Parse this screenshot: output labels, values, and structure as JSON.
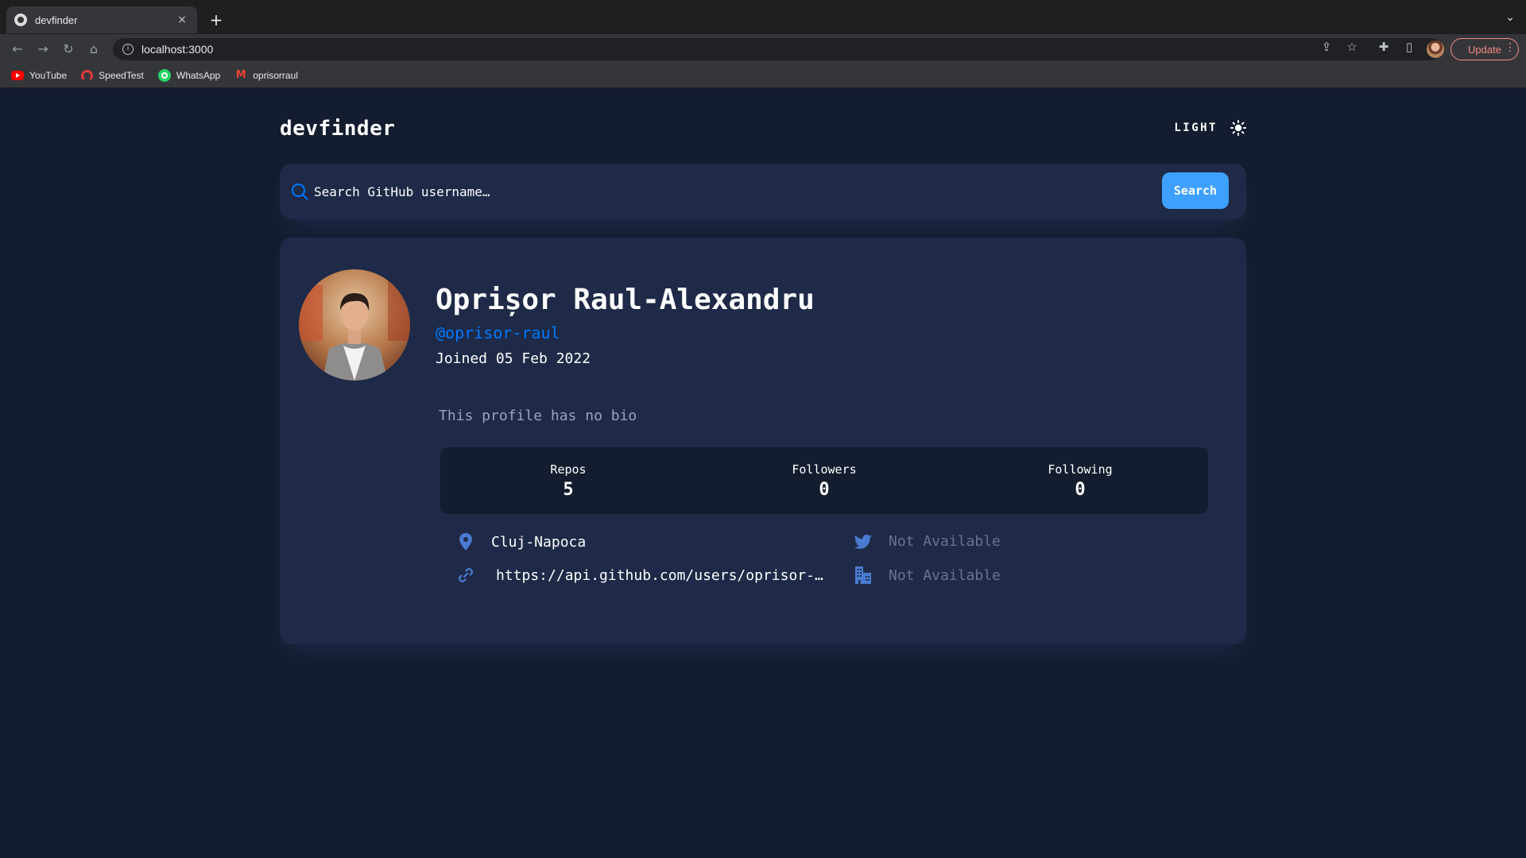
{
  "browser": {
    "tab_title": "devfinder",
    "tab_close_glyph": "×",
    "new_tab_glyph": "+",
    "url": "localhost:3000",
    "update_label": "Update",
    "bookmarks": [
      {
        "label": "YouTube",
        "icon": "youtube-icon"
      },
      {
        "label": "SpeedTest",
        "icon": "speedtest-icon"
      },
      {
        "label": "WhatsApp",
        "icon": "whatsapp-icon"
      },
      {
        "label": "oprisorraul",
        "icon": "gmail-icon"
      }
    ]
  },
  "header": {
    "logo": "devfinder",
    "theme_label": "LIGHT"
  },
  "search": {
    "placeholder": "Search GitHub username…",
    "value": "",
    "button_label": "Search"
  },
  "profile": {
    "name": "Oprișor Raul-Alexandru",
    "handle": "@oprisor-raul",
    "joined": "Joined 05 Feb 2022",
    "bio": "This profile has no bio",
    "stats": [
      {
        "label": "Repos",
        "value": "5"
      },
      {
        "label": "Followers",
        "value": "0"
      },
      {
        "label": "Following",
        "value": "0"
      }
    ],
    "location": "Cluj-Napoca",
    "blog": "https://api.github.com/users/oprisor-…",
    "twitter": "Not Available",
    "company": "Not Available"
  },
  "colors": {
    "page_bg": "#141d2f",
    "card_bg": "#1e2a47",
    "accent": "#0079ff",
    "button": "#3ea0fe",
    "muted": "#69738d"
  }
}
